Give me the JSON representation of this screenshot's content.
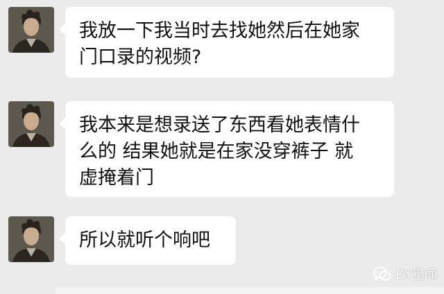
{
  "messages": [
    {
      "lines": [
        "我放一下我当时去找她然后在她家",
        "门口录的视频?"
      ]
    },
    {
      "lines": [
        "我本来是想录送了东西看她表情什",
        "么的 结果她就是在家没穿裤子 就",
        "虚掩着门"
      ]
    },
    {
      "lines": [
        "所以就听个响吧"
      ]
    }
  ],
  "watermark": {
    "text": "DY星闻",
    "icon": "wechat-icon"
  },
  "colors": {
    "background": "#ebebeb",
    "bubble": "#ffffff",
    "text": "#111111"
  }
}
